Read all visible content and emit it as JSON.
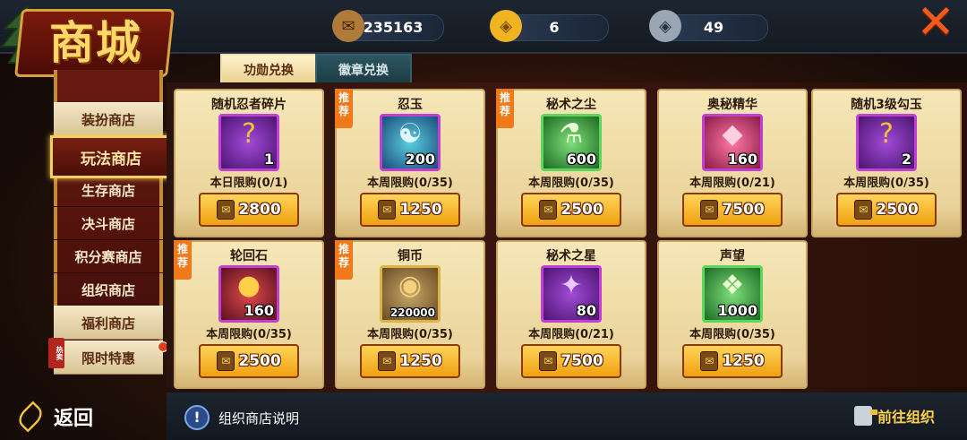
{
  "app": {
    "title": "商城"
  },
  "header": {
    "currencies": [
      {
        "icon": "honor-medal-icon",
        "value": "235163"
      },
      {
        "icon": "gold-coin-icon",
        "value": "6"
      },
      {
        "icon": "silver-coin-icon",
        "value": "49"
      }
    ],
    "close_glyph": "✕"
  },
  "sidebar": {
    "items": [
      {
        "label": "装扮商店"
      },
      {
        "label": "玩法商店"
      },
      {
        "label": "生存商店"
      },
      {
        "label": "决斗商店"
      },
      {
        "label": "积分赛商店"
      },
      {
        "label": "组织商店"
      },
      {
        "label": "福利商店"
      },
      {
        "label": "限时特惠",
        "tag": "热卖"
      }
    ],
    "active": "玩法商店"
  },
  "back": {
    "label": "返回"
  },
  "tabs": [
    {
      "label": "功勋兑换",
      "active": true
    },
    {
      "label": "徽章兑换",
      "active": false
    }
  ],
  "recommend_label": "推荐",
  "items": [
    {
      "name": "随机忍者碎片",
      "qty": "1",
      "limit": "本日限购(0/1)",
      "price": "2800",
      "recommended": false,
      "glyph": "?",
      "style": "purple"
    },
    {
      "name": "忍玉",
      "qty": "200",
      "limit": "本周限购(0/35)",
      "price": "1250",
      "recommended": true,
      "glyph": "☯",
      "style": "purple"
    },
    {
      "name": "秘术之尘",
      "qty": "600",
      "limit": "本周限购(0/35)",
      "price": "2500",
      "recommended": true,
      "glyph": "⚗",
      "style": "purple"
    },
    {
      "name": "奥秘精华",
      "qty": "160",
      "limit": "本周限购(0/21)",
      "price": "7500",
      "recommended": false,
      "glyph": "◆",
      "style": "purple"
    },
    {
      "name": "随机3级勾玉",
      "qty": "2",
      "limit": "本周限购(0/35)",
      "price": "2500",
      "recommended": false,
      "glyph": "?",
      "style": "purple"
    },
    {
      "name": "轮回石",
      "qty": "160",
      "limit": "本周限购(0/35)",
      "price": "2500",
      "recommended": true,
      "glyph": "●",
      "style": "purple"
    },
    {
      "name": "铜币",
      "qty": "220000",
      "limit": "本周限购(0/35)",
      "price": "1250",
      "recommended": true,
      "glyph": "◉",
      "style": "gold"
    },
    {
      "name": "秘术之星",
      "qty": "80",
      "limit": "本周限购(0/21)",
      "price": "7500",
      "recommended": false,
      "glyph": "✦",
      "style": "purple"
    },
    {
      "name": "声望",
      "qty": "1000",
      "limit": "本周限购(0/35)",
      "price": "1250",
      "recommended": false,
      "glyph": "❖",
      "style": "green"
    }
  ],
  "footer": {
    "info_text": "组织商店说明",
    "goto_label": "前往组织"
  }
}
